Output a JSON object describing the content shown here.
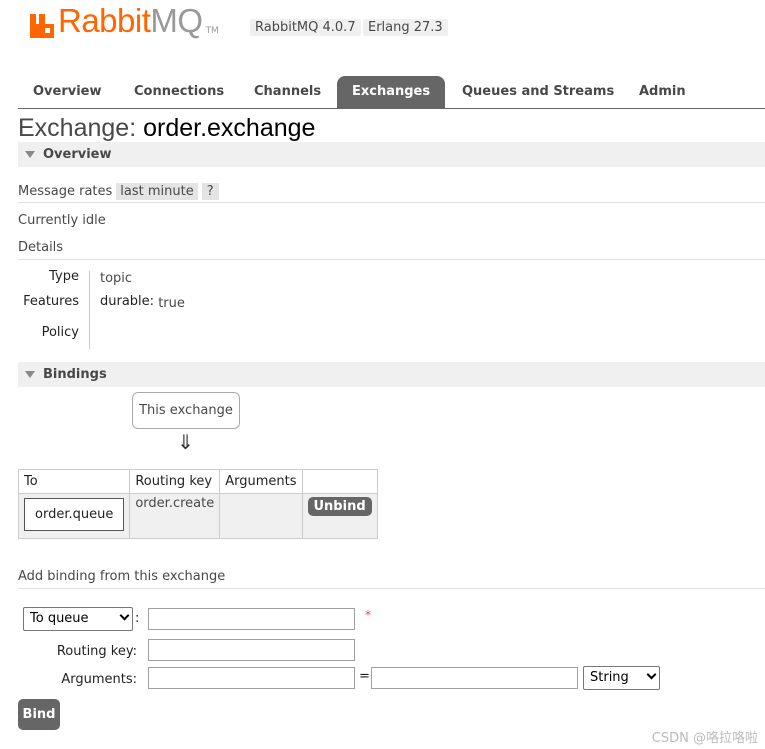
{
  "header": {
    "logo_text_rabbit": "Rabbit",
    "logo_text_mq": "MQ",
    "logo_tm": "TM",
    "rabbitmq_version": "RabbitMQ 4.0.7",
    "erlang_version": "Erlang 27.3",
    "brand_color": "#ff6600"
  },
  "tabs": [
    {
      "label": "Overview",
      "active": false
    },
    {
      "label": "Connections",
      "active": false
    },
    {
      "label": "Channels",
      "active": false
    },
    {
      "label": "Exchanges",
      "active": true
    },
    {
      "label": "Queues and Streams",
      "active": false
    },
    {
      "label": "Admin",
      "active": false
    }
  ],
  "page": {
    "title_prefix": "Exchange:",
    "exchange_name": "order.exchange"
  },
  "overview": {
    "section_title": "Overview",
    "message_rates_label": "Message rates",
    "message_rates_period": "last minute",
    "help_label": "?",
    "status_text": "Currently idle",
    "details_label": "Details",
    "details": {
      "type_label": "Type",
      "type_value": "topic",
      "features_label": "Features",
      "feature_key": "durable:",
      "feature_value": "true",
      "policy_label": "Policy",
      "policy_value": ""
    }
  },
  "bindings": {
    "section_title": "Bindings",
    "this_exchange_label": "This exchange",
    "arrow_glyph": "⇓",
    "table": {
      "headers": [
        "To",
        "Routing key",
        "Arguments",
        ""
      ],
      "rows": [
        {
          "to": "order.queue",
          "routing_key": "order.create",
          "arguments": "",
          "action": "Unbind"
        }
      ]
    }
  },
  "add_binding": {
    "title": "Add binding from this exchange",
    "destination_type_selected": "To queue",
    "destination_colon": ":",
    "destination_value": "",
    "required_mark": "*",
    "routing_key_label": "Routing key:",
    "routing_key_value": "",
    "arguments_label": "Arguments:",
    "argument_key": "",
    "equals": "=",
    "argument_value": "",
    "argument_type_selected": "String",
    "bind_button": "Bind"
  },
  "watermark": "CSDN @咯拉咯啦"
}
